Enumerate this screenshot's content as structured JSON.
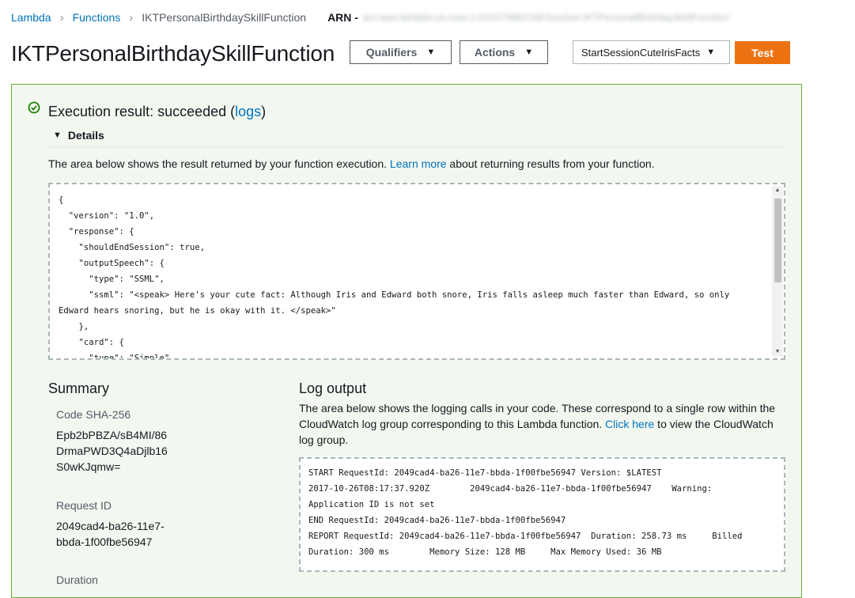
{
  "breadcrumb": {
    "lambda": "Lambda",
    "functions": "Functions",
    "current": "IKTPersonalBirthdaySkillFunction",
    "arn_label": "ARN -",
    "arn_value": "arn:aws:lambda:us-east-1:011574662158:function:IKTPersonalBirthdaySkillFunction"
  },
  "header": {
    "title": "IKTPersonalBirthdaySkillFunction",
    "qualifiers_label": "Qualifiers",
    "actions_label": "Actions",
    "test_event": "StartSessionCuteIrisFacts",
    "test_label": "Test"
  },
  "result": {
    "title_prefix": "Execution result: succeeded (",
    "logs_link": "logs",
    "title_suffix": ")",
    "details_label": "Details",
    "desc_prefix": "The area below shows the result returned by your function execution. ",
    "learn_more": "Learn more",
    "desc_suffix": " about returning results from your function.",
    "code": "{\n  \"version\": \"1.0\",\n  \"response\": {\n    \"shouldEndSession\": true,\n    \"outputSpeech\": {\n      \"type\": \"SSML\",\n      \"ssml\": \"<speak> Here's your cute fact: Although Iris and Edward both snore, Iris falls asleep much faster than Edward, so only\nEdward hears snoring, but he is okay with it. </speak>\"\n    },\n    \"card\": {\n      \"type\": \"Simple\","
  },
  "summary": {
    "title": "Summary",
    "sha_label": "Code SHA-256",
    "sha_lines": [
      "Epb2bPBZA/sB4MI/86",
      "DrmaPWD3Q4aDjlb16",
      "S0wKJqmw="
    ],
    "request_label": "Request ID",
    "request_lines": [
      "2049cad4-ba26-11e7-",
      "bbda-1f00fbe56947"
    ],
    "duration_label": "Duration"
  },
  "log": {
    "title": "Log output",
    "desc_prefix": "The area below shows the logging calls in your code. These correspond to a single row within the CloudWatch log group corresponding to this Lambda function. ",
    "click_here": "Click here",
    "desc_suffix": " to view the CloudWatch log group.",
    "text": "START RequestId: 2049cad4-ba26-11e7-bbda-1f00fbe56947 Version: $LATEST\n2017-10-26T08:17:37.920Z        2049cad4-ba26-11e7-bbda-1f00fbe56947    Warning:\nApplication ID is not set\nEND RequestId: 2049cad4-ba26-11e7-bbda-1f00fbe56947\nREPORT RequestId: 2049cad4-ba26-11e7-bbda-1f00fbe56947  Duration: 258.73 ms     Billed\nDuration: 300 ms        Memory Size: 128 MB     Max Memory Used: 36 MB"
  },
  "colors": {
    "link": "#0073bb",
    "success": "#1d8102",
    "primary_button": "#ec7211",
    "panel_border": "#6aaf35",
    "panel_bg": "#f2f8f0"
  },
  "icons": {
    "success": "check-circle-icon",
    "breadcrumb_separator": "chevron-right-icon",
    "dropdown": "caret-down-icon",
    "details_toggle": "triangle-down-icon"
  }
}
